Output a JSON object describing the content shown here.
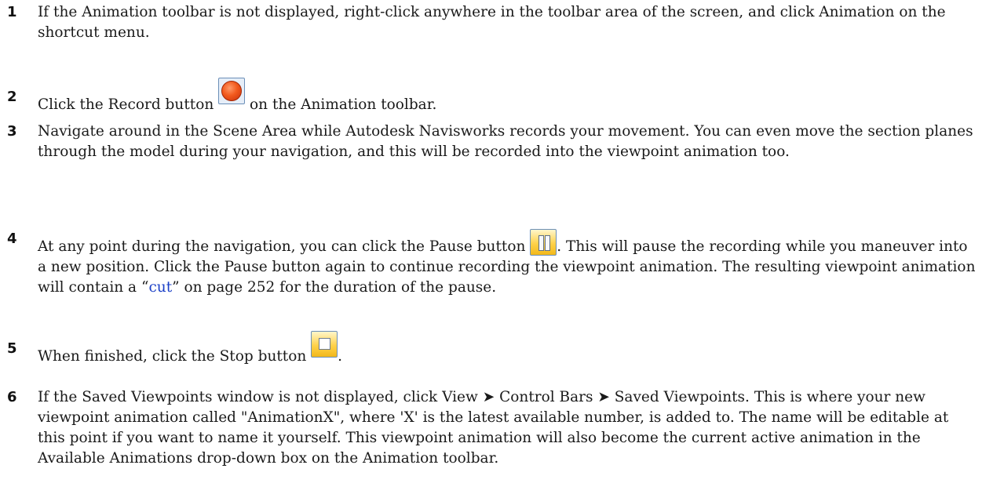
{
  "steps": [
    {
      "num": "1",
      "text": "If the Animation toolbar is not displayed, right-click anywhere in the toolbar area of the screen, and click Animation on the shortcut menu."
    },
    {
      "num": "2",
      "before": "Click the Record button",
      "after": " on the Animation toolbar.",
      "icon": "record-icon"
    },
    {
      "num": "3",
      "text": "Navigate around in the Scene Area while Autodesk Navisworks records your movement. You can even move the section planes through the model during your navigation, and this will be recorded into the viewpoint animation too."
    },
    {
      "num": "4",
      "before": "At any point during the navigation, you can click the Pause button",
      "after": ". This will pause the recording while you maneuver into a new position. Click the Pause button again to continue recording the viewpoint animation. The resulting viewpoint animation will contain a “",
      "link": "cut",
      "after2": "” on page 252 for the duration of the pause.",
      "icon": "pause-icon"
    },
    {
      "num": "5",
      "before": "When finished, click the Stop button",
      "after": ".",
      "icon": "stop-icon"
    },
    {
      "num": "6",
      "text": "If the Saved Viewpoints window is not displayed, click View ➤ Control Bars ➤ Saved Viewpoints. This is where your new viewpoint animation called \"AnimationX\", where 'X' is the latest available number, is added to. The name will be editable at this point if you want to name it yourself. This viewpoint animation will also become the current active animation in the Available Animations drop-down box on the Animation toolbar."
    }
  ]
}
